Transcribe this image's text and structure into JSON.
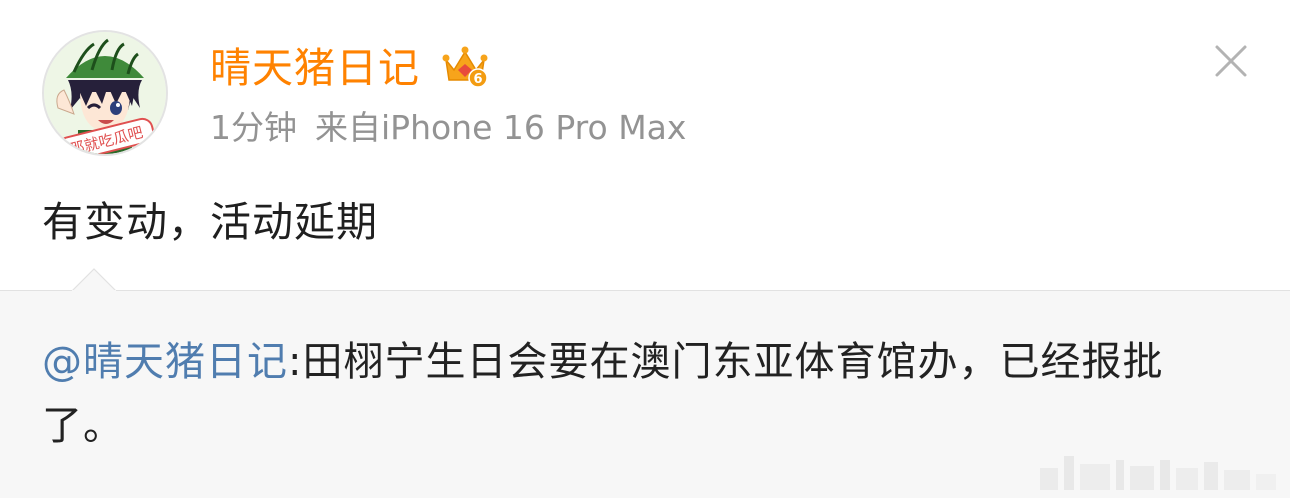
{
  "post": {
    "author": {
      "name": "晴天猪日记",
      "avatar_icon": "anime-boy-watermelon-hat-avatar",
      "avatar_caption": "那就吃瓜吧",
      "badge_icon": "vip-crown-badge-icon",
      "badge_level": "6"
    },
    "time": "1分钟",
    "source": "来自iPhone 16 Pro Max",
    "text": "有变动，活动延期",
    "close_icon": "close-icon"
  },
  "quote": {
    "mention": "@晴天猪日记",
    "body": ":田栩宁生日会要在澳门东亚体育馆办，已经报批了。"
  },
  "colors": {
    "username": "#ff8200",
    "meta": "#939393",
    "mention": "#507daf",
    "quote_bg": "#f7f7f7",
    "text": "#1f1f1f"
  }
}
